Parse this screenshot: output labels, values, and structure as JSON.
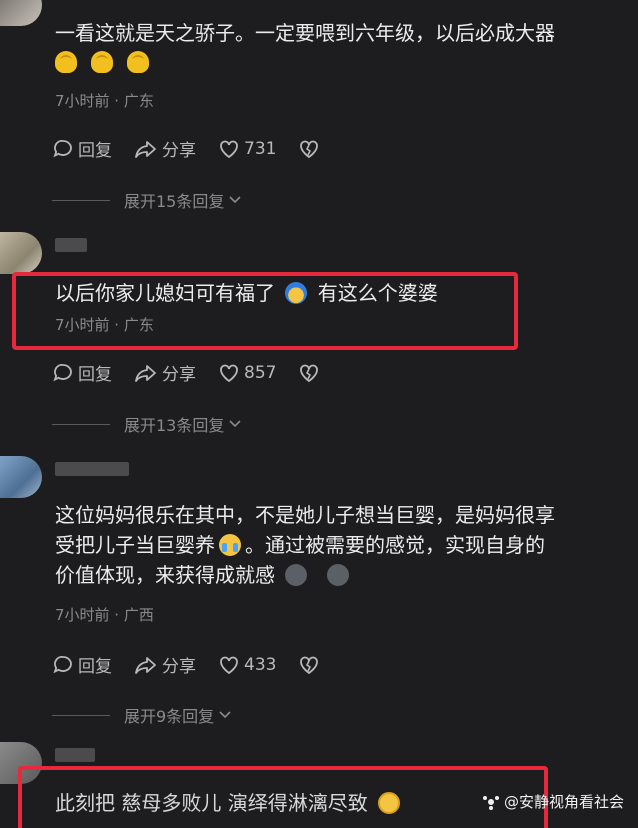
{
  "comments": [
    {
      "text": "一看这就是天之骄子。一定要喂到六年级，以后必成大器",
      "meta": "7小时前 · 广东",
      "reply": "回复",
      "share": "分享",
      "likes": "731",
      "expand": "展开15条回复"
    },
    {
      "text_a": "以后你家儿媳妇可有福了",
      "text_b": "有这么个婆婆",
      "meta": "7小时前 · 广东",
      "reply": "回复",
      "share": "分享",
      "likes": "857",
      "expand": "展开13条回复"
    },
    {
      "text_line1": "这位妈妈很乐在其中，不是她儿子想当巨婴，是妈妈很享",
      "text_line2a": "受把儿子当巨婴养",
      "text_line2b": "。通过被需要的感觉，实现自身的",
      "text_line3": "价值体现，来获得成就感",
      "meta": "7小时前 · 广西",
      "reply": "回复",
      "share": "分享",
      "likes": "433",
      "expand": "展开9条回复"
    },
    {
      "text": "此刻把 慈母多败儿 演绎得淋漓尽致"
    }
  ],
  "watermark": "@安静视角看社会",
  "colors": {
    "highlight": "#e8283c",
    "background": "#1d1d1f"
  }
}
